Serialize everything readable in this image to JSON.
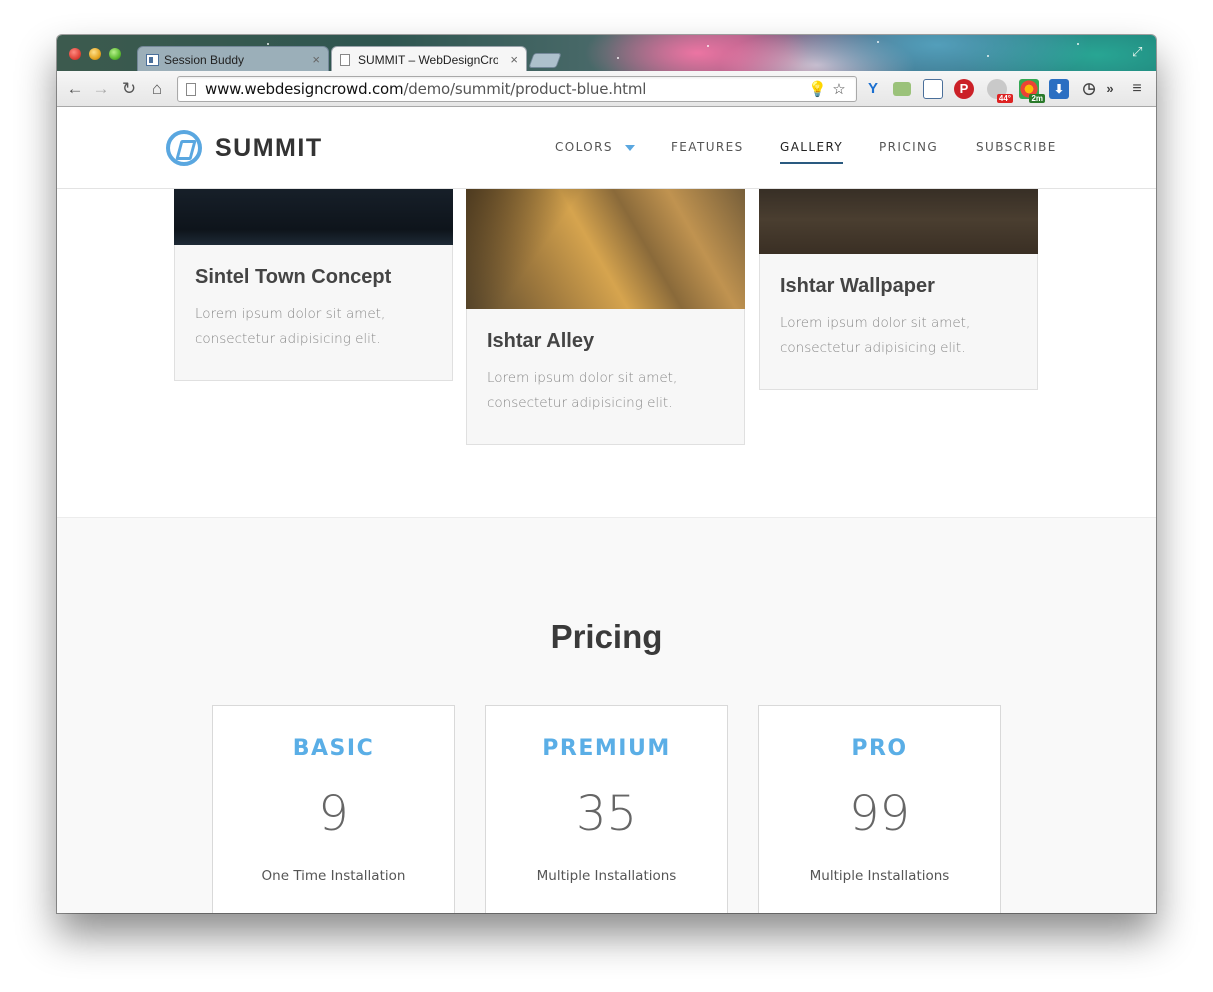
{
  "browser": {
    "tabs": [
      {
        "title": "Session Buddy",
        "close": "×"
      },
      {
        "title": "SUMMIT – WebDesignCrow",
        "close": "×"
      }
    ],
    "url": {
      "host": "www.webdesigncrowd.com",
      "path": "/demo/summit/product-blue.html"
    },
    "extensions": {
      "badge_weather": "44°",
      "badge_timer": "2m",
      "overflow": "»"
    }
  },
  "site": {
    "logo_text": "SUMMIT",
    "nav": [
      "COLORS",
      "FEATURES",
      "GALLERY",
      "PRICING",
      "SUBSCRIBE"
    ],
    "active_nav": "GALLERY",
    "accent_color": "#5aaee6"
  },
  "gallery": [
    {
      "title": "Sintel Town Concept",
      "desc": "Lorem ipsum dolor sit amet, consectetur adipisicing elit."
    },
    {
      "title": "Ishtar Alley",
      "desc": "Lorem ipsum dolor sit amet, consectetur adipisicing elit."
    },
    {
      "title": "Ishtar Wallpaper",
      "desc": "Lorem ipsum dolor sit amet, consectetur adipisicing elit."
    }
  ],
  "pricing": {
    "heading": "Pricing",
    "plans": [
      {
        "name": "BASIC",
        "price": "9",
        "note": "One Time Installation"
      },
      {
        "name": "PREMIUM",
        "price": "35",
        "note": "Multiple Installations"
      },
      {
        "name": "PRO",
        "price": "99",
        "note": "Multiple Installations"
      }
    ]
  }
}
